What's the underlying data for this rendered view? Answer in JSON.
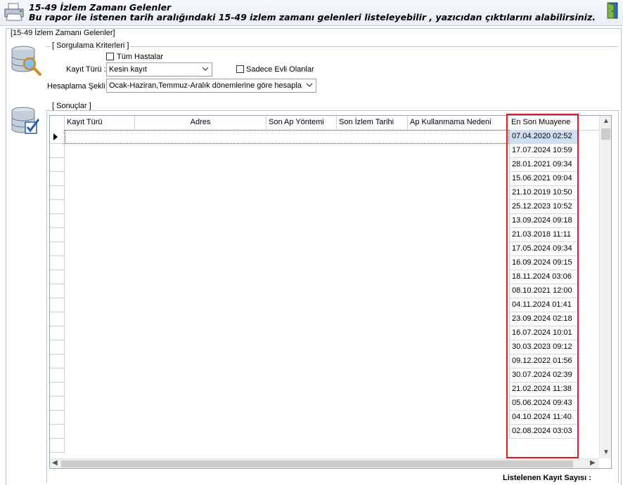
{
  "header": {
    "title": "15-49 İzlem Zamanı Gelenler",
    "description": "Bu rapor ile istenen tarih aralığındaki 15-49 izlem zamanı gelenleri listeleyebilir ,  yazıcıdan çıktılarını alabilirsiniz."
  },
  "panel": {
    "title": "[15-49 İzlem Zamanı Gelenler]"
  },
  "criteria": {
    "title": "[ Sorgulama Kriterleri ]",
    "all_patients_label": "Tüm Hastalar",
    "all_patients_checked": false,
    "kayit_turu_label": "Kayıt Türü :",
    "kayit_turu_value": "Kesin kayıt",
    "only_evli_label": "Sadece Evli Olanlar",
    "only_evli_checked": false,
    "hesaplama_label": "Hesaplama Şekli :",
    "hesaplama_value": "Ocak-Haziran,Temmuz-Aralık dönemlerine göre hesapla"
  },
  "results": {
    "title": "[ Sonuçlar  ]",
    "columns": [
      "Kayıt Türü",
      "Adres",
      "Son Ap Yöntemi",
      "Son İzlem Tarihi",
      "Ap Kullanmama Nedeni",
      "En Son Muayene"
    ],
    "en_son_muayene": [
      "07.04.2020 02:52",
      "17.07.2024 10:59",
      "28.01.2021 09:34",
      "15.06.2021 09:04",
      "21.10.2019 10:50",
      "25.12.2023 10:52",
      "13.09.2024 09:18",
      "21.03.2018 11:11",
      "17.05.2024 09:34",
      "16.09.2024 09:15",
      "18.11.2024 03:06",
      "08.10.2021 12:00",
      "04.11.2024 01:41",
      "23.09.2024 02:18",
      "16.07.2024 10:01",
      "30.03.2023 09:12",
      "09.12.2022 01:56",
      "30.07.2024 02:39",
      "21.02.2024 11:38",
      "05.06.2024 09:43",
      "04.10.2024 11:40",
      "02.08.2024 03:03"
    ]
  },
  "footer": {
    "count_label": "Listelenen Kayıt Sayısı :"
  },
  "colors": {
    "highlight": "#e0191e",
    "selected_cell": "#cfe0f4"
  }
}
